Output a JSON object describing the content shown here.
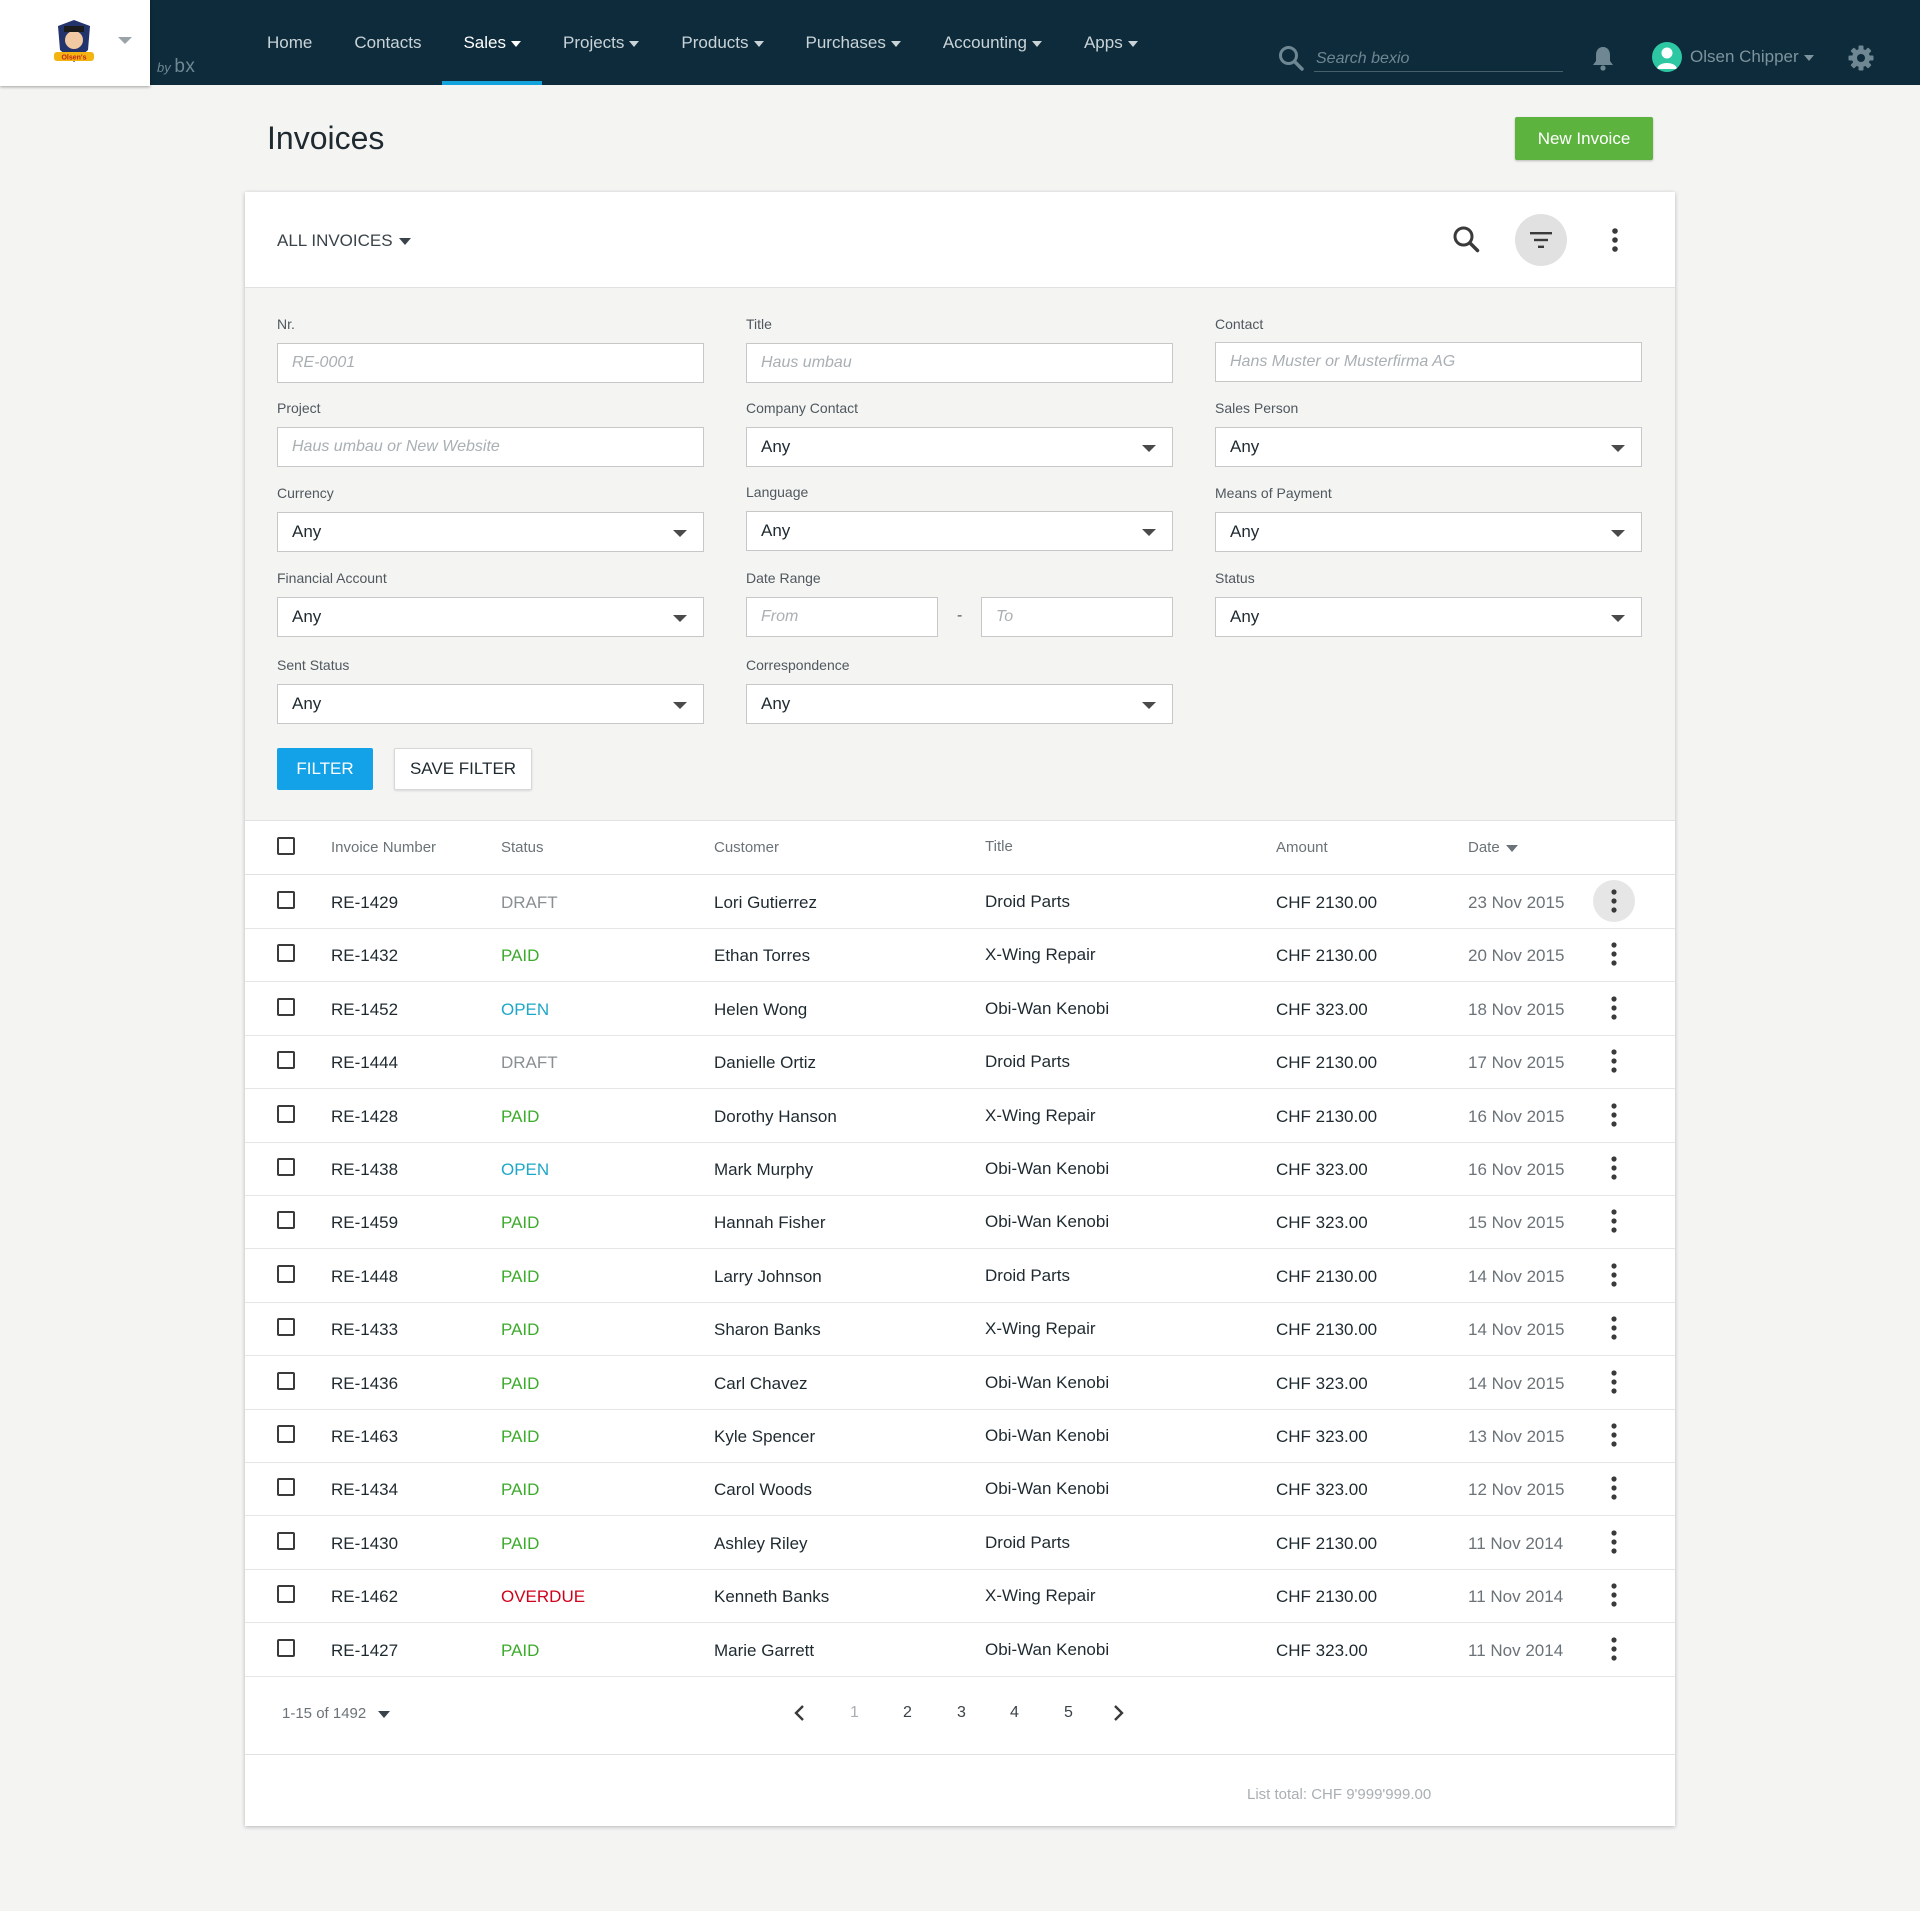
{
  "brand": {
    "logo_text": "Olsen's",
    "byline_prefix": "by",
    "byline_mark": "bx"
  },
  "nav": {
    "items": [
      {
        "label": "Home",
        "dropdown": false,
        "active": false
      },
      {
        "label": "Contacts",
        "dropdown": false,
        "active": false
      },
      {
        "label": "Sales",
        "dropdown": true,
        "active": true
      },
      {
        "label": "Projects",
        "dropdown": true,
        "active": false
      },
      {
        "label": "Products",
        "dropdown": true,
        "active": false
      },
      {
        "label": "Purchases",
        "dropdown": true,
        "active": false
      },
      {
        "label": "Accounting",
        "dropdown": true,
        "active": false
      },
      {
        "label": "Apps",
        "dropdown": true,
        "active": false
      }
    ],
    "search_placeholder": "Search bexio",
    "user_name": "Olsen Chipper"
  },
  "page": {
    "title": "Invoices",
    "new_button": "New Invoice"
  },
  "list": {
    "view_label": "ALL INVOICES"
  },
  "filters": {
    "nr": {
      "label": "Nr.",
      "placeholder": "RE-0001"
    },
    "title": {
      "label": "Title",
      "placeholder": "Haus umbau"
    },
    "contact": {
      "label": "Contact",
      "placeholder": "Hans Muster or Musterfirma AG"
    },
    "project": {
      "label": "Project",
      "placeholder": "Haus umbau or New Website"
    },
    "company_contact": {
      "label": "Company Contact",
      "value": "Any"
    },
    "sales_person": {
      "label": "Sales Person",
      "value": "Any"
    },
    "currency": {
      "label": "Currency",
      "value": "Any"
    },
    "language": {
      "label": "Language",
      "value": "Any"
    },
    "means_of_payment": {
      "label": "Means of Payment",
      "value": "Any"
    },
    "financial_account": {
      "label": "Financial Account",
      "value": "Any"
    },
    "date_range": {
      "label": "Date Range",
      "from_placeholder": "From",
      "separator": "-",
      "to_placeholder": "To"
    },
    "status": {
      "label": "Status",
      "value": "Any"
    },
    "sent_status": {
      "label": "Sent Status",
      "value": "Any"
    },
    "correspondence": {
      "label": "Correspondence",
      "value": "Any"
    },
    "filter_button": "FILTER",
    "save_button": "SAVE FILTER"
  },
  "table": {
    "headers": {
      "number": "Invoice Number",
      "status": "Status",
      "customer": "Customer",
      "title": "Title",
      "amount": "Amount",
      "date": "Date"
    },
    "status_colors": {
      "DRAFT": "#8a8f92",
      "PAID": "#3cab2b",
      "OPEN": "#1ea7c8",
      "OVERDUE": "#d0021b"
    },
    "rows": [
      {
        "number": "RE-1429",
        "status": "DRAFT",
        "customer": "Lori Gutierrez",
        "title": "Droid Parts",
        "amount": "CHF 2130.00",
        "date": "23 Nov 2015"
      },
      {
        "number": "RE-1432",
        "status": "PAID",
        "customer": "Ethan Torres",
        "title": "X-Wing Repair",
        "amount": "CHF 2130.00",
        "date": "20 Nov 2015"
      },
      {
        "number": "RE-1452",
        "status": "OPEN",
        "customer": "Helen Wong",
        "title": "Obi-Wan Kenobi",
        "amount": "CHF 323.00",
        "date": "18 Nov 2015"
      },
      {
        "number": "RE-1444",
        "status": "DRAFT",
        "customer": "Danielle Ortiz",
        "title": "Droid Parts",
        "amount": "CHF 2130.00",
        "date": "17 Nov 2015"
      },
      {
        "number": "RE-1428",
        "status": "PAID",
        "customer": "Dorothy Hanson",
        "title": "X-Wing Repair",
        "amount": "CHF 2130.00",
        "date": "16 Nov 2015"
      },
      {
        "number": "RE-1438",
        "status": "OPEN",
        "customer": "Mark Murphy",
        "title": "Obi-Wan Kenobi",
        "amount": "CHF 323.00",
        "date": "16 Nov 2015"
      },
      {
        "number": "RE-1459",
        "status": "PAID",
        "customer": "Hannah Fisher",
        "title": "Obi-Wan Kenobi",
        "amount": "CHF 323.00",
        "date": "15 Nov 2015"
      },
      {
        "number": "RE-1448",
        "status": "PAID",
        "customer": "Larry Johnson",
        "title": "Droid Parts",
        "amount": "CHF 2130.00",
        "date": "14 Nov 2015"
      },
      {
        "number": "RE-1433",
        "status": "PAID",
        "customer": "Sharon Banks",
        "title": "X-Wing Repair",
        "amount": "CHF 2130.00",
        "date": "14 Nov 2015"
      },
      {
        "number": "RE-1436",
        "status": "PAID",
        "customer": "Carl Chavez",
        "title": "Obi-Wan Kenobi",
        "amount": "CHF 323.00",
        "date": "14 Nov 2015"
      },
      {
        "number": "RE-1463",
        "status": "PAID",
        "customer": "Kyle Spencer",
        "title": "Obi-Wan Kenobi",
        "amount": "CHF 323.00",
        "date": "13 Nov 2015"
      },
      {
        "number": "RE-1434",
        "status": "PAID",
        "customer": "Carol Woods",
        "title": "Obi-Wan Kenobi",
        "amount": "CHF 323.00",
        "date": "12 Nov 2015"
      },
      {
        "number": "RE-1430",
        "status": "PAID",
        "customer": "Ashley Riley",
        "title": "Droid Parts",
        "amount": "CHF 2130.00",
        "date": "11 Nov 2014"
      },
      {
        "number": "RE-1462",
        "status": "OVERDUE",
        "customer": "Kenneth Banks",
        "title": "X-Wing Repair",
        "amount": "CHF 2130.00",
        "date": "11 Nov 2014"
      },
      {
        "number": "RE-1427",
        "status": "PAID",
        "customer": "Marie Garrett",
        "title": "Obi-Wan Kenobi",
        "amount": "CHF 323.00",
        "date": "11 Nov 2014"
      }
    ]
  },
  "pagination": {
    "range": "1-15 of 1492",
    "pages": [
      "1",
      "2",
      "3",
      "4",
      "5"
    ],
    "current": "1"
  },
  "footer": {
    "list_total": "List total: CHF 9'999'999.00"
  },
  "colors": {
    "topbar": "#0d2b3a",
    "accent": "#13a2dc",
    "new_button": "#5cb33d",
    "filter_button": "#13a2e8"
  },
  "icons": [
    "search-icon",
    "bell-icon",
    "user-icon",
    "gear-icon",
    "filter-icon",
    "more-vertical-icon",
    "chevron-left-icon",
    "chevron-right-icon",
    "caret-down-icon"
  ]
}
